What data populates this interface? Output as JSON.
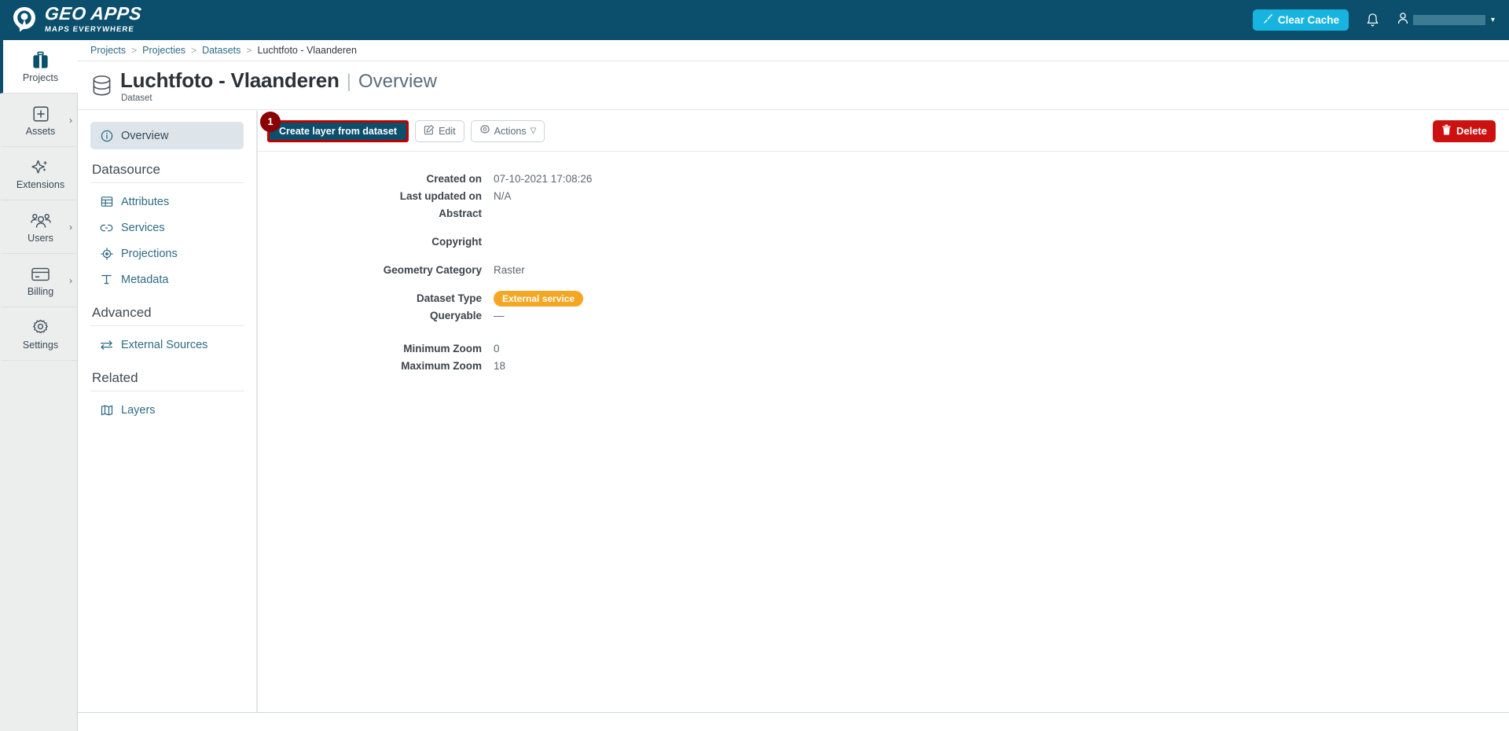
{
  "topbar": {
    "logo_title": "GEO APPS",
    "logo_sub": "MAPS EVERYWHERE",
    "logo_icon": "map-pin-logo-icon",
    "clear_cache_label": "Clear Cache",
    "clear_cache_icon": "broom-icon",
    "bell_icon": "notification-bell-icon",
    "user_icon": "user-avatar-icon",
    "user_name": "",
    "caret_icon": "chevron-down-icon",
    "bg_color": "#0b4f6c",
    "accent_color": "#18b4e0"
  },
  "rail": {
    "items": [
      {
        "label": "Projects",
        "icon": "briefcase-icon",
        "active": true,
        "chevron": false
      },
      {
        "label": "Assets",
        "icon": "plus-box-icon",
        "active": false,
        "chevron": true
      },
      {
        "label": "Extensions",
        "icon": "sparkle-icon",
        "active": false,
        "chevron": false
      },
      {
        "label": "Users",
        "icon": "users-icon",
        "active": false,
        "chevron": true
      },
      {
        "label": "Billing",
        "icon": "credit-card-icon",
        "active": false,
        "chevron": true
      },
      {
        "label": "Settings",
        "icon": "gear-icon",
        "active": false,
        "chevron": false
      }
    ]
  },
  "breadcrumb": {
    "items": [
      "Projects",
      "Projecties",
      "Datasets",
      "Luchtfoto - Vlaanderen"
    ],
    "separator": ">"
  },
  "page_head": {
    "icon": "database-icon",
    "title": "Luchtfoto - Vlaanderen",
    "pipe": "|",
    "section": "Overview",
    "subtitle": "Dataset"
  },
  "leftnav": {
    "overview": {
      "label": "Overview",
      "icon": "info-circle-icon"
    },
    "groups": [
      {
        "title": "Datasource",
        "items": [
          {
            "label": "Attributes",
            "icon": "table-icon"
          },
          {
            "label": "Services",
            "icon": "link-icon"
          },
          {
            "label": "Projections",
            "icon": "crosshair-icon"
          },
          {
            "label": "Metadata",
            "icon": "text-t-icon"
          }
        ]
      },
      {
        "title": "Advanced",
        "items": [
          {
            "label": "External Sources",
            "icon": "exchange-arrows-icon"
          }
        ]
      },
      {
        "title": "Related",
        "items": [
          {
            "label": "Layers",
            "icon": "layers-icon"
          }
        ]
      }
    ]
  },
  "toolbar": {
    "step_number": "1",
    "create_layer_label": "Create layer from dataset",
    "edit_label": "Edit",
    "edit_icon": "pencil-square-icon",
    "actions_label": "Actions",
    "actions_icon": "gear-icon",
    "actions_caret": "▽",
    "delete_label": "Delete",
    "delete_icon": "trash-icon",
    "highlight_color": "#c00000",
    "primary_color": "#0b4f6c",
    "danger_color": "#cc1111"
  },
  "details": {
    "created_on_label": "Created on",
    "created_on_value": "07-10-2021 17:08:26",
    "last_updated_label": "Last updated on",
    "last_updated_value": "N/A",
    "abstract_label": "Abstract",
    "abstract_value": "",
    "copyright_label": "Copyright",
    "copyright_value": "",
    "geometry_category_label": "Geometry Category",
    "geometry_category_value": "Raster",
    "dataset_type_label": "Dataset Type",
    "dataset_type_value": "External service",
    "dataset_type_color": "#f5a623",
    "queryable_label": "Queryable",
    "queryable_value": "—",
    "min_zoom_label": "Minimum Zoom",
    "min_zoom_value": "0",
    "max_zoom_label": "Maximum Zoom",
    "max_zoom_value": "18"
  }
}
